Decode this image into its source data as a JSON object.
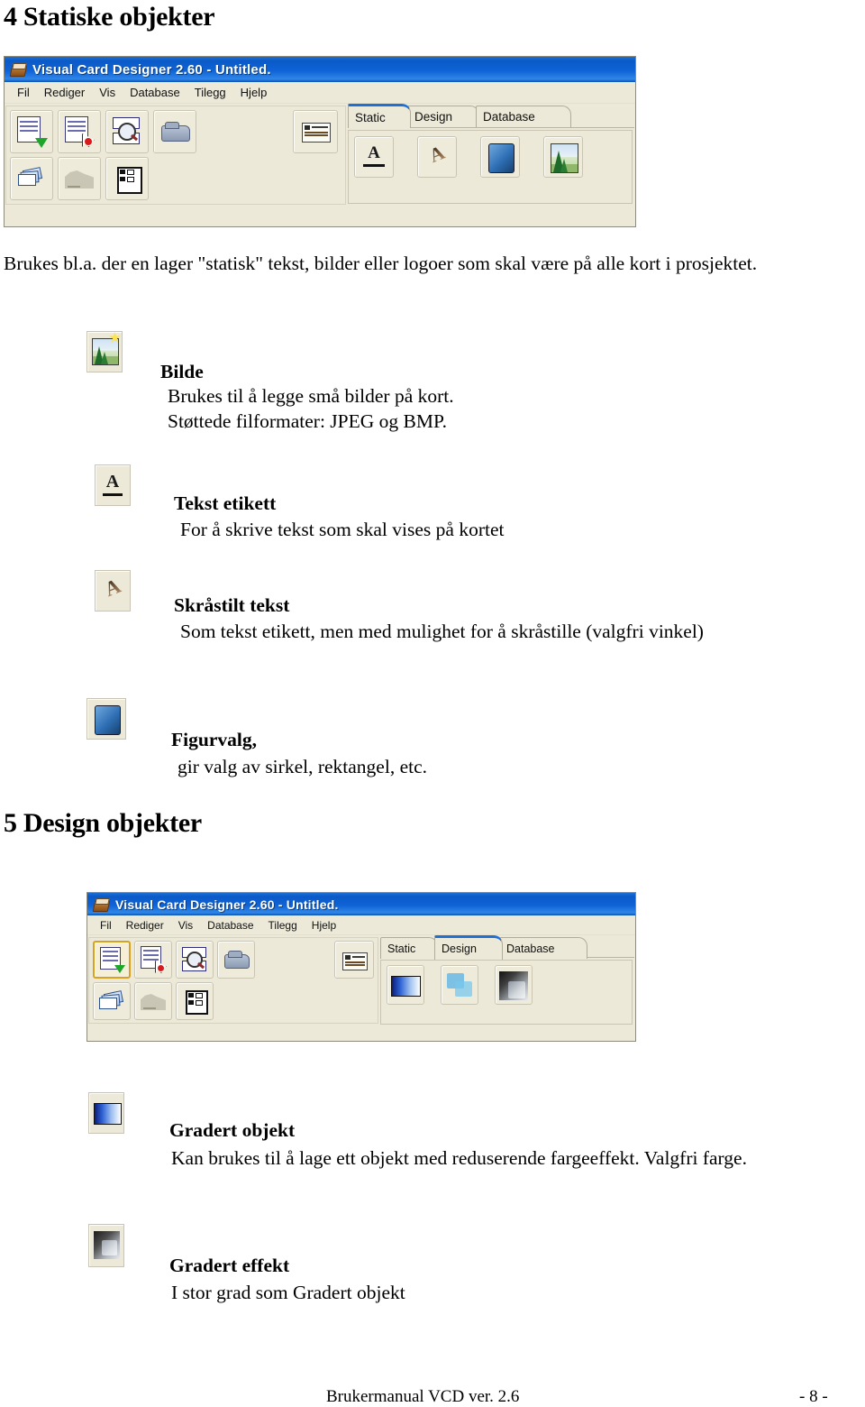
{
  "document": {
    "heading_4": "4 Statiske objekter",
    "heading_5": "5 Design objekter",
    "intro_paragraph": "Brukes bl.a. der en lager \"statisk\" tekst, bilder eller logoer som skal være på alle kort i prosjektet.",
    "footer_left": "Brukermanual VCD ver. 2.6",
    "footer_right": "- 8 -"
  },
  "static_items": [
    {
      "icon": "picture-icon",
      "title": "Bilde",
      "desc_line1": "Brukes til å legge små bilder på kort.",
      "desc_line2": "Støttede filformater: JPEG og BMP."
    },
    {
      "icon": "text-label-icon",
      "title": "Tekst etikett",
      "desc_line1": "For å skrive tekst som skal vises på kortet"
    },
    {
      "icon": "slanted-text-icon",
      "title": "Skråstilt tekst",
      "desc_line1": "Som tekst etikett, men med mulighet for å skråstille (valgfri vinkel)"
    },
    {
      "icon": "shape-select-icon",
      "title": "Figurvalg,",
      "desc_line1": "gir valg av sirkel, rektangel, etc."
    }
  ],
  "design_items": [
    {
      "icon": "gradient-object-icon",
      "title": "Gradert objekt",
      "desc_line1": "Kan brukes til å lage ett objekt med reduserende fargeeffekt. Valgfri farge."
    },
    {
      "icon": "gradient-effect-icon",
      "title": "Gradert effekt",
      "desc_line1": "I stor grad som Gradert objekt"
    }
  ],
  "app_window_static": {
    "title": "Visual Card Designer 2.60 - Untitled.",
    "menu": [
      "Fil",
      "Rediger",
      "Vis",
      "Database",
      "Tilegg",
      "Hjelp"
    ],
    "toolbar_buttons": [
      "save-document-icon",
      "close-document-icon",
      "preview-search-icon",
      "print-icon",
      "card-layout-icon",
      "cards-stack-icon",
      "signature-icon",
      "grid-table-icon"
    ],
    "tabs": [
      {
        "label": "Static",
        "active": true
      },
      {
        "label": "Design",
        "active": false
      },
      {
        "label": "Database",
        "active": false
      }
    ],
    "palette_buttons": [
      "text-label-icon",
      "slanted-text-icon",
      "shape-select-icon",
      "picture-icon"
    ]
  },
  "app_window_design": {
    "title": "Visual Card Designer 2.60 - Untitled.",
    "menu": [
      "Fil",
      "Rediger",
      "Vis",
      "Database",
      "Tilegg",
      "Hjelp"
    ],
    "toolbar_buttons": [
      "save-document-icon",
      "close-document-icon",
      "preview-search-icon",
      "print-icon",
      "card-layout-icon",
      "cards-stack-icon",
      "signature-icon",
      "grid-table-icon"
    ],
    "tabs": [
      {
        "label": "Static",
        "active": false
      },
      {
        "label": "Design",
        "active": true
      },
      {
        "label": "Database",
        "active": false
      }
    ],
    "palette_buttons": [
      "gradient-object-icon",
      "overlap-shapes-icon",
      "gradient-effect-icon"
    ],
    "colors": {
      "titlebar": "#0a5ac8",
      "window_face": "#ece9d8",
      "tab_active_accent": "#1f6fd4",
      "toolbar_hot_border": "#d9a024"
    }
  }
}
